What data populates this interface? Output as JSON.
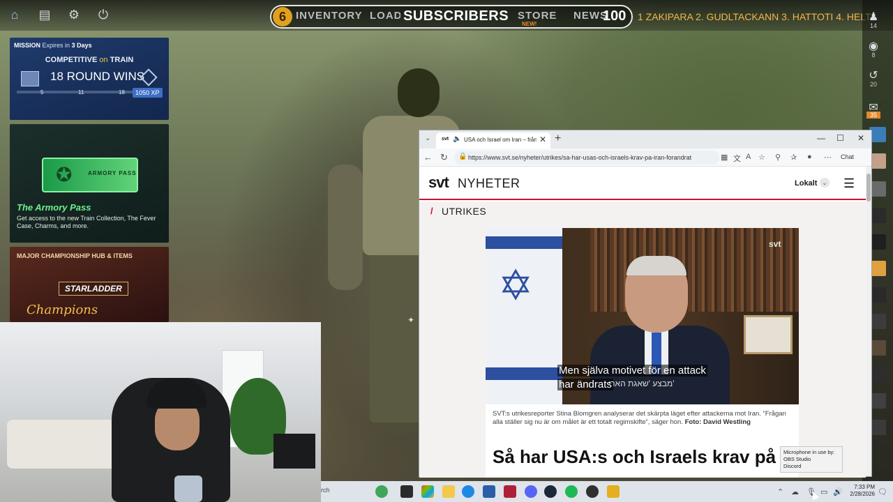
{
  "top_bar": {
    "home_icon": "home-icon",
    "level": "6",
    "nav_items": [
      "INVENTORY",
      "LOADOUT",
      "STORE",
      "NEWS"
    ],
    "subscribers_label": "SUBSCRIBERS",
    "news_count": "100",
    "store_badge": "NEW!",
    "ticker": "1 ZAKIPARA 2. GUDLTACKANN  3. HATTOTI 4. HELTANOMAN"
  },
  "right_strip": {
    "counts": [
      "14",
      "8",
      "20",
      "35"
    ]
  },
  "mission_card": {
    "label": "MISSION",
    "expires_text": "Expires in",
    "expires_value": "3 Days",
    "title_pre": "COMPETITIVE",
    "title_on": "on",
    "title_map": "TRAIN",
    "wins": "18 ROUND WINS",
    "ticks": [
      "5",
      "11",
      "18"
    ],
    "xp": "1050 XP"
  },
  "armory_card": {
    "badge_left": "ARMORY",
    "badge_right": "PASS",
    "title": "The Armory Pass",
    "description": "Get access to the new Train Collection, The Fever Case, Charms, and more."
  },
  "major_card": {
    "title": "MAJOR CHAMPIONSHIP HUB & ITEMS",
    "logo": "STARLADDER",
    "script": "Champions"
  },
  "browser": {
    "tab_title": "USA och Israel om Iran – från",
    "tab_favicon": "svt",
    "url": "https://www.svt.se/nyheter/utrikes/sa-har-usas-och-israels-krav-pa-iran-forandrat",
    "chat_label": "Chat",
    "brand_svt": "svt",
    "brand_nyheter": "NYHETER",
    "lokalt": "Lokalt",
    "section": "UTRIKES",
    "video_watermark": "svt",
    "subtitle_line1": "Men själva motivet för en attack",
    "subtitle_line2": "har ändrats",
    "subtitle_hebrew": "מבצע 'שאגת הארי'",
    "caption": "SVT:s utrikesreporter Stina Blomgren analyserar det skärpta läget efter attackerna mot Iran. ”Frågan alla ställer sig nu är om målet är ett totalt regimskifte”, säger hon.",
    "caption_photo": "Foto: David Westling",
    "headline": "Så har USA:s och Israels krav på"
  },
  "taskbar": {
    "search_fragment": "rch",
    "time": "7:33 PM",
    "date": "2/28/2026"
  },
  "tooltip": {
    "title": "Microphone in use by:",
    "app1": "OBS Studio",
    "app2": "Discord"
  }
}
